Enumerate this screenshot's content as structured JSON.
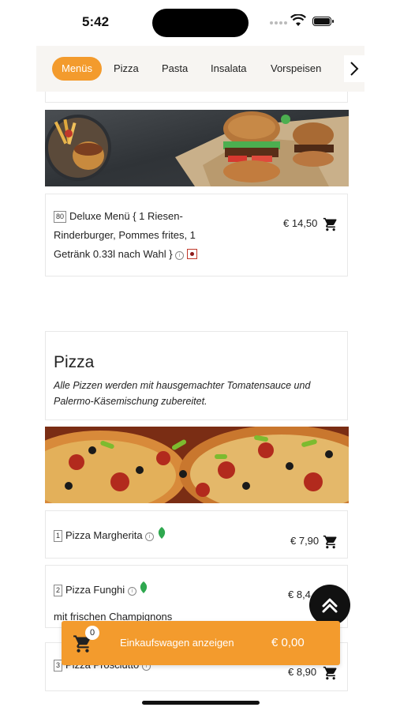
{
  "status": {
    "time": "5:42"
  },
  "categories": {
    "items": [
      "Menüs",
      "Pizza",
      "Pasta",
      "Insalata",
      "Vorspeisen"
    ],
    "active": "Menüs"
  },
  "menu_item": {
    "number": "80",
    "line1": "Deluxe Menü { 1 Riesen-",
    "line2": "Rinderburger, Pommes frites, 1",
    "line3": "Getränk 0.33l nach Wahl }",
    "info_glyph": "i",
    "price": "€ 14,50"
  },
  "pizza_section": {
    "title": "Pizza",
    "description_line1": "Alle Pizzen werden mit hausgemachter Tomatensauce und",
    "description_line2": "Palermo-Käsemischung zubereitet."
  },
  "pizzas": [
    {
      "number": "1",
      "name": "Pizza Margherita",
      "price": "€ 7,90",
      "icon": "leaf-icon"
    },
    {
      "number": "2",
      "name": "Pizza Funghi",
      "price": "€ 8,4",
      "description": "mit frischen Champignons",
      "icon": "leaf-icon"
    },
    {
      "number": "3",
      "name": "Pizza Prosciutto",
      "price": "€ 8,90"
    }
  ],
  "cart": {
    "count": "0",
    "label": "Einkaufswagen anzeigen",
    "total": "€ 0,00"
  },
  "colors": {
    "accent": "#f39b2d",
    "leaf": "#2fa84f",
    "dark": "#111111"
  }
}
